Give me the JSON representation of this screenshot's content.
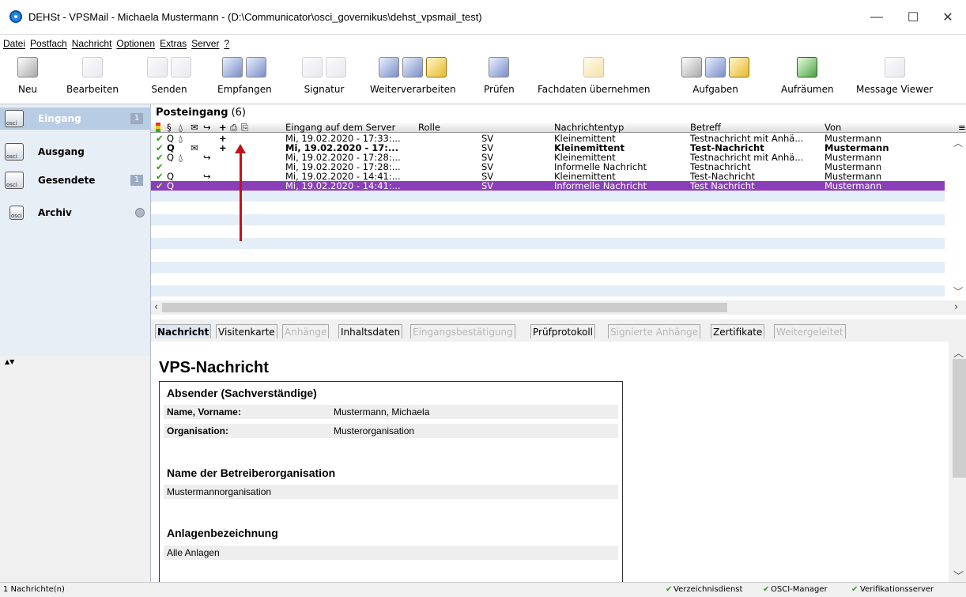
{
  "window": {
    "title": "DEHSt - VPSMail - Michaela Mustermann - (D:\\Communicator\\osci_governikus\\dehst_vpsmail_test)",
    "minimize": "—",
    "maximize": "☐",
    "close": "✕"
  },
  "menu": [
    "Datei",
    "Postfach",
    "Nachricht",
    "Optionen",
    "Extras",
    "Server",
    "?"
  ],
  "toolbar": {
    "neu": "Neu",
    "bearbeiten": "Bearbeiten",
    "senden": "Senden",
    "empfangen": "Empfangen",
    "signatur": "Signatur",
    "weiterverarbeiten": "Weiterverarbeiten",
    "pruefen": "Prüfen",
    "fachdaten": "Fachdaten übernehmen",
    "aufgaben": "Aufgaben",
    "aufraeumen": "Aufräumen",
    "viewer": "Message Viewer"
  },
  "nav": {
    "eingang": {
      "label": "Eingang",
      "count": "1"
    },
    "ausgang": {
      "label": "Ausgang"
    },
    "gesendete": {
      "label": "Gesendete",
      "count": "1"
    },
    "archiv": {
      "label": "Archiv"
    }
  },
  "list": {
    "title": "Posteingang",
    "count": "(6)",
    "headers": {
      "flags": "§",
      "plus": "+",
      "eingang": "Eingang auf dem Server",
      "rolle": "Rolle",
      "typ": "Nachrichtentyp",
      "betreff": "Betreff",
      "von": "Von"
    },
    "rows": [
      {
        "check": "✔",
        "q": "Q",
        "clip": "⍙",
        "env": "",
        "arrow": "",
        "plus": "+",
        "date": "Mi, 19.02.2020 - 17:33:...",
        "rolle": "SV",
        "typ": "Kleinemittent",
        "betreff": "Testnachricht mit Anhä...",
        "von": "Mustermann"
      },
      {
        "check": "✔",
        "q": "Q",
        "clip": "",
        "env": "✉",
        "arrow": "",
        "plus": "+",
        "date": "Mi, 19.02.2020 - 17:...",
        "rolle": "SV",
        "typ": "Kleinemittent",
        "betreff": "Test-Nachricht",
        "von": "Mustermann"
      },
      {
        "check": "✔",
        "q": "Q",
        "clip": "⍙",
        "env": "",
        "arrow": "↪",
        "plus": "",
        "date": "Mi, 19.02.2020 - 17:28:...",
        "rolle": "SV",
        "typ": "Kleinemittent",
        "betreff": "Testnachricht mit Anhä...",
        "von": "Mustermann"
      },
      {
        "check": "✔",
        "q": "",
        "clip": "",
        "env": "",
        "arrow": "",
        "plus": "",
        "date": "Mi, 19.02.2020 - 17:28:...",
        "rolle": "SV",
        "typ": "Informelle Nachricht",
        "betreff": "Testnachricht",
        "von": "Mustermann"
      },
      {
        "check": "✔",
        "q": "Q",
        "clip": "",
        "env": "",
        "arrow": "↪",
        "plus": "",
        "date": "Mi, 19.02.2020 - 14:41:...",
        "rolle": "SV",
        "typ": "Kleinemittent",
        "betreff": "Test-Nachricht",
        "von": "Mustermann"
      },
      {
        "check": "✔",
        "q": "Q",
        "clip": "",
        "env": "",
        "arrow": "",
        "plus": "",
        "date": "Mi, 19.02.2020 - 14:41:...",
        "rolle": "SV",
        "typ": "Informelle Nachricht",
        "betreff": "Test Nachricht",
        "von": "Mustermann"
      }
    ]
  },
  "tabs": [
    {
      "label": "Nachricht",
      "state": "active"
    },
    {
      "label": "Visitenkarte",
      "state": "normal"
    },
    {
      "label": "Anhänge",
      "state": "disabled"
    },
    {
      "label": "Inhaltsdaten",
      "state": "normal"
    },
    {
      "label": "Eingangsbestätigung",
      "state": "disabled"
    },
    {
      "label": "Prüfprotokoll",
      "state": "normal"
    },
    {
      "label": "Signierte Anhänge",
      "state": "disabled"
    },
    {
      "label": "Zertifikate",
      "state": "normal"
    },
    {
      "label": "Weitergeleitet",
      "state": "disabled"
    }
  ],
  "detail": {
    "heading": "VPS-Nachricht",
    "absender_title": "Absender (Sachverständige)",
    "name_label": "Name, Vorname:",
    "name_value": "Mustermann, Michaela",
    "org_label": "Organisation:",
    "org_value": "Musterorganisation",
    "betreiber_title": "Name der Betreiberorganisation",
    "betreiber_value": "Mustermannorganisation",
    "anlagen_title": "Anlagenbezeichnung",
    "anlagen_value": "Alle Anlagen"
  },
  "status": {
    "left": "1 Nachrichte(n)",
    "verzeichnis": "Verzeichnisdienst",
    "osci": "OSCI-Manager",
    "verifikation": "Verifikationsserver",
    "tick": "✔"
  },
  "colors": {
    "selected_row": "#8a3fb8",
    "nav_selected": "#b8cce4",
    "check_green": "#2e9a1a",
    "annotation_arrow": "#c0141c"
  }
}
